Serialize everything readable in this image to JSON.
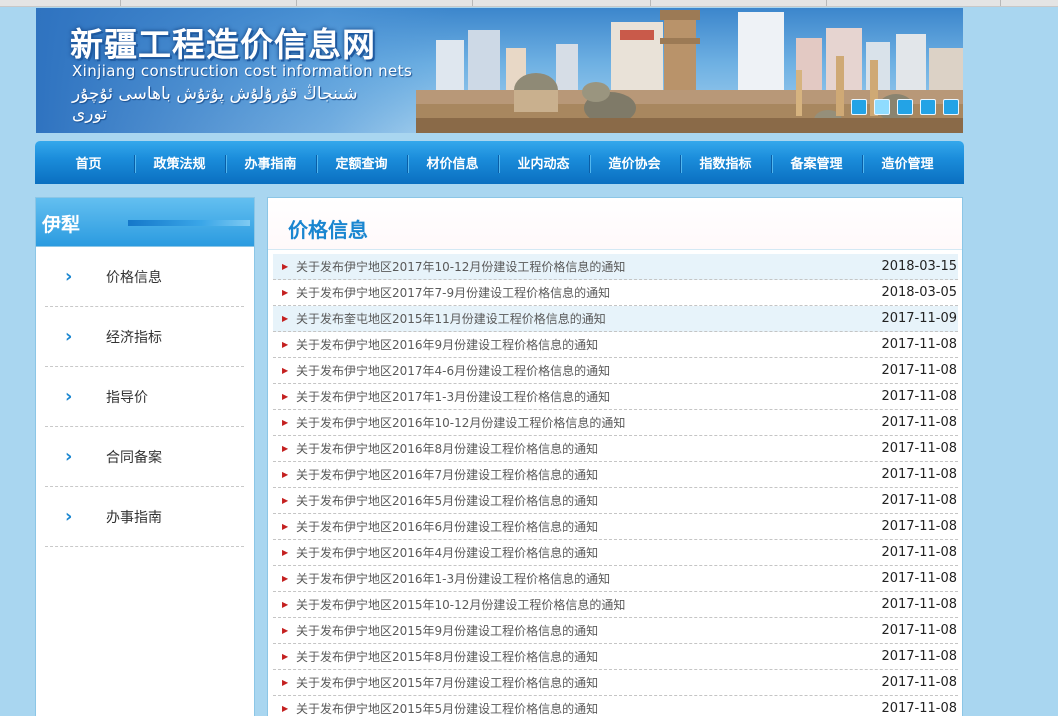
{
  "site": {
    "title_cn": "新疆工程造价信息网",
    "title_en": "Xinjiang construction cost information nets",
    "title_ug": "شىنجاڭ قۇرۇلۇش پۇتۇش باھاسى ئۇچۇر تورى"
  },
  "nav": {
    "items": [
      "首页",
      "政策法规",
      "办事指南",
      "定额查询",
      "材价信息",
      "业内动态",
      "造价协会",
      "指数指标",
      "备案管理",
      "造价管理"
    ]
  },
  "sidebar": {
    "title": "伊犁",
    "items": [
      "价格信息",
      "经济指标",
      "指导价",
      "合同备案",
      "办事指南"
    ]
  },
  "main": {
    "title": "价格信息",
    "rows": [
      {
        "title": "关于发布伊宁地区2017年10-12月份建设工程价格信息的通知",
        "date": "2018-03-15"
      },
      {
        "title": "关于发布伊宁地区2017年7-9月份建设工程价格信息的通知",
        "date": "2018-03-05"
      },
      {
        "title": "关于发布奎屯地区2015年11月份建设工程价格信息的通知",
        "date": "2017-11-09"
      },
      {
        "title": "关于发布伊宁地区2016年9月份建设工程价格信息的通知",
        "date": "2017-11-08"
      },
      {
        "title": "关于发布伊宁地区2017年4-6月份建设工程价格信息的通知",
        "date": "2017-11-08"
      },
      {
        "title": "关于发布伊宁地区2017年1-3月份建设工程价格信息的通知",
        "date": "2017-11-08"
      },
      {
        "title": "关于发布伊宁地区2016年10-12月份建设工程价格信息的通知",
        "date": "2017-11-08"
      },
      {
        "title": "关于发布伊宁地区2016年8月份建设工程价格信息的通知",
        "date": "2017-11-08"
      },
      {
        "title": "关于发布伊宁地区2016年7月份建设工程价格信息的通知",
        "date": "2017-11-08"
      },
      {
        "title": "关于发布伊宁地区2016年5月份建设工程价格信息的通知",
        "date": "2017-11-08"
      },
      {
        "title": "关于发布伊宁地区2016年6月份建设工程价格信息的通知",
        "date": "2017-11-08"
      },
      {
        "title": "关于发布伊宁地区2016年4月份建设工程价格信息的通知",
        "date": "2017-11-08"
      },
      {
        "title": "关于发布伊宁地区2016年1-3月份建设工程价格信息的通知",
        "date": "2017-11-08"
      },
      {
        "title": "关于发布伊宁地区2015年10-12月份建设工程价格信息的通知",
        "date": "2017-11-08"
      },
      {
        "title": "关于发布伊宁地区2015年9月份建设工程价格信息的通知",
        "date": "2017-11-08"
      },
      {
        "title": "关于发布伊宁地区2015年8月份建设工程价格信息的通知",
        "date": "2017-11-08"
      },
      {
        "title": "关于发布伊宁地区2015年7月份建设工程价格信息的通知",
        "date": "2017-11-08"
      },
      {
        "title": "关于发布伊宁地区2015年5月份建设工程价格信息的通知",
        "date": "2017-11-08"
      }
    ]
  },
  "icons": {
    "sidebar_chevron": "chevron-right-icon",
    "row_marker": "red-arrow-icon"
  },
  "colors": {
    "page_bg": "#a9d6f0",
    "nav_blue": "#1b8ddb",
    "accent_blue": "#1a86d0",
    "row_alt": "#e7f3fa",
    "arrow_red": "#c42020",
    "panel_border": "#8cc6e6"
  }
}
